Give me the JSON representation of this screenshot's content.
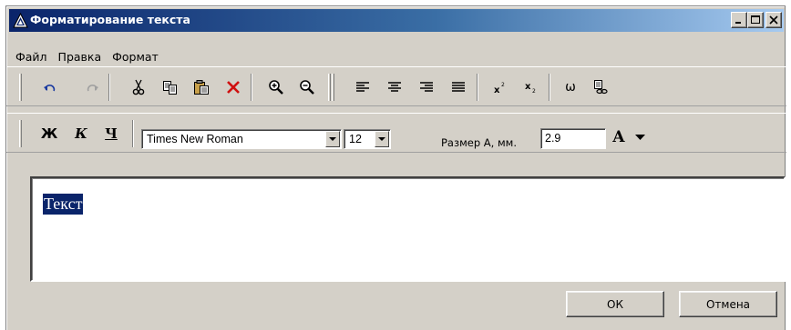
{
  "window": {
    "title": "Форматирование текста",
    "colors": {
      "titlebar_start": "#0a246a",
      "titlebar_end": "#a6caf0",
      "face": "#d4d0c8"
    }
  },
  "menu": {
    "items": [
      "Файл",
      "Правка",
      "Формат"
    ]
  },
  "toolbar": {
    "buttons": [
      {
        "icon": "undo-icon"
      },
      {
        "icon": "redo-icon"
      },
      {
        "icon": "cut-icon"
      },
      {
        "icon": "copy-icon"
      },
      {
        "icon": "paste-icon"
      },
      {
        "icon": "delete-icon"
      },
      {
        "icon": "zoom-in-icon"
      },
      {
        "icon": "zoom-out-icon"
      },
      {
        "icon": "align-left-icon"
      },
      {
        "icon": "align-center-icon"
      },
      {
        "icon": "align-right-icon"
      },
      {
        "icon": "align-justify-icon"
      },
      {
        "icon": "superscript-icon"
      },
      {
        "icon": "subscript-icon"
      },
      {
        "icon": "symbol-icon",
        "label": "ω"
      },
      {
        "icon": "link-icon"
      }
    ]
  },
  "format": {
    "bold_label": "Ж",
    "italic_label": "К",
    "underline_label": "Ч",
    "font_name": "Times New Roman",
    "font_size": "12",
    "size_label": "Размер А, мм.",
    "size_value": "2.9",
    "font_color_label": "А"
  },
  "editor": {
    "text": "Текст"
  },
  "buttons": {
    "ok": "ОК",
    "cancel": "Отмена"
  }
}
